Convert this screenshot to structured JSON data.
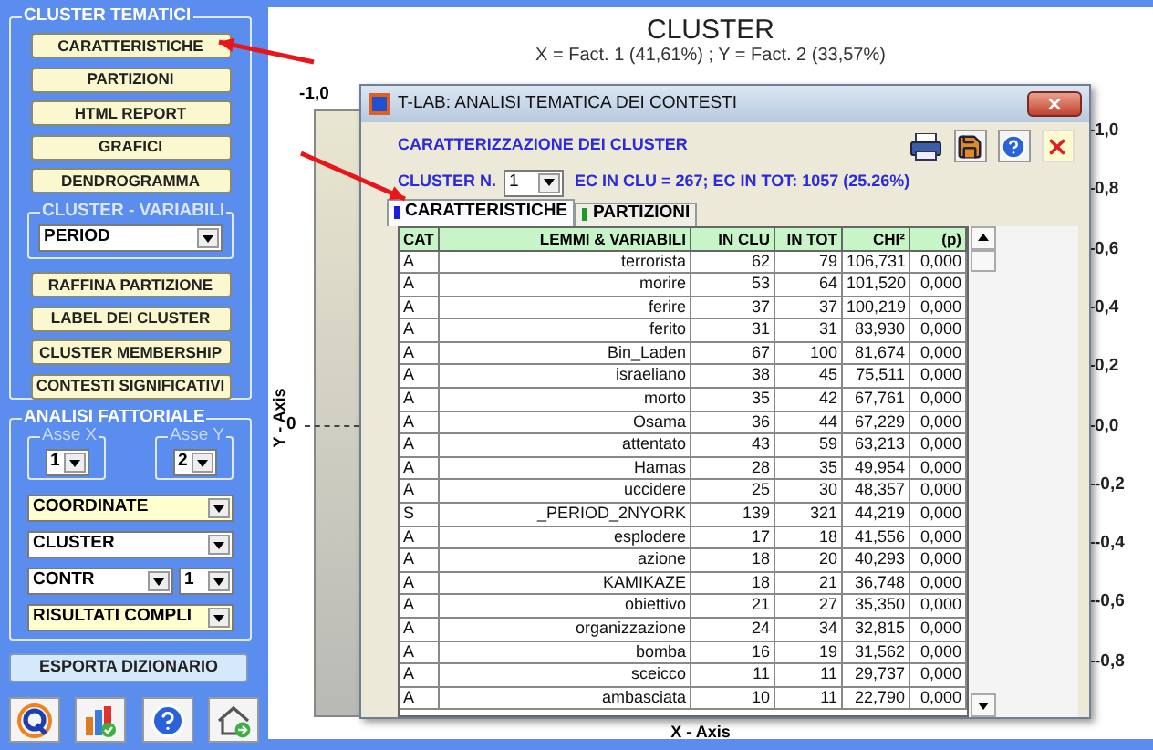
{
  "sidebar": {
    "cluster_group": {
      "title": "CLUSTER TEMATICI",
      "buttons": [
        "CARATTERISTICHE",
        "PARTIZIONI",
        "HTML REPORT",
        "GRAFICI",
        "DENDROGRAMMA"
      ],
      "variables": {
        "title": "CLUSTER - VARIABILI",
        "value": "PERIOD"
      },
      "buttons_2": [
        "RAFFINA PARTIZIONE",
        "LABEL DEI CLUSTER",
        "CLUSTER MEMBERSHIP",
        "CONTESTI SIGNIFICATIVI"
      ]
    },
    "factorial_group": {
      "title": "ANALISI FATTORIALE",
      "axis_x": {
        "label": "Asse X",
        "value": "1"
      },
      "axis_y": {
        "label": "Asse Y",
        "value": "2"
      },
      "select_rows": [
        [
          {
            "value": "COORDINATE",
            "highlighted": true
          }
        ],
        [
          {
            "value": "CLUSTER",
            "highlighted": false
          }
        ],
        [
          {
            "value": "CONTR",
            "highlighted": false
          },
          {
            "value": "1",
            "highlighted": false
          }
        ],
        [
          {
            "value": "RISULTATI COMPLI",
            "highlighted": true
          }
        ]
      ]
    },
    "export_button": "ESPORTA DIZIONARIO"
  },
  "chart": {
    "title": "CLUSTER",
    "subtitle": "X = Fact. 1 (41,61%) ; Y = Fact. 2 (33,57%)",
    "top_tick": "-1,0",
    "left_tick": "0",
    "right_ticks": [
      "1,0",
      "0,8",
      "0,6",
      "0,4",
      "0,2",
      "0,0",
      "-0,2",
      "-0,4",
      "-0,6",
      "-0,8"
    ],
    "x_axis_label": "X - Axis",
    "y_axis_label": "Y - Axis"
  },
  "dialog": {
    "title": "T-LAB: ANALISI TEMATICA DEI CONTESTI",
    "heading": "CARATTERIZZAZIONE DEI CLUSTER",
    "cluster_label": "CLUSTER N.",
    "cluster_value": "1",
    "summary": "EC IN CLU = 267; EC IN TOT: 1057 (25.26%)",
    "tabs": [
      {
        "label": "CARATTERISTICHE",
        "selected": true
      },
      {
        "label": "PARTIZIONI",
        "selected": false
      }
    ],
    "table": {
      "columns": [
        "CAT",
        "LEMMI & VARIABILI",
        "IN CLU",
        "IN TOT",
        "CHI²",
        "(p)"
      ],
      "rows": [
        [
          "A",
          "terrorista",
          "62",
          "79",
          "106,731",
          "0,000"
        ],
        [
          "A",
          "morire",
          "53",
          "64",
          "101,520",
          "0,000"
        ],
        [
          "A",
          "ferire",
          "37",
          "37",
          "100,219",
          "0,000"
        ],
        [
          "A",
          "ferito",
          "31",
          "31",
          "83,930",
          "0,000"
        ],
        [
          "A",
          "Bin_Laden",
          "67",
          "100",
          "81,674",
          "0,000"
        ],
        [
          "A",
          "israeliano",
          "38",
          "45",
          "75,511",
          "0,000"
        ],
        [
          "A",
          "morto",
          "35",
          "42",
          "67,761",
          "0,000"
        ],
        [
          "A",
          "Osama",
          "36",
          "44",
          "67,229",
          "0,000"
        ],
        [
          "A",
          "attentato",
          "43",
          "59",
          "63,213",
          "0,000"
        ],
        [
          "A",
          "Hamas",
          "28",
          "35",
          "49,954",
          "0,000"
        ],
        [
          "A",
          "uccidere",
          "25",
          "30",
          "48,357",
          "0,000"
        ],
        [
          "S",
          "_PERIOD_2NYORK",
          "139",
          "321",
          "44,219",
          "0,000"
        ],
        [
          "A",
          "esplodere",
          "17",
          "18",
          "41,556",
          "0,000"
        ],
        [
          "A",
          "azione",
          "18",
          "20",
          "40,293",
          "0,000"
        ],
        [
          "A",
          "KAMIKAZE",
          "18",
          "21",
          "36,748",
          "0,000"
        ],
        [
          "A",
          "obiettivo",
          "21",
          "27",
          "35,350",
          "0,000"
        ],
        [
          "A",
          "organizzazione",
          "24",
          "34",
          "32,815",
          "0,000"
        ],
        [
          "A",
          "bomba",
          "16",
          "19",
          "31,562",
          "0,000"
        ],
        [
          "A",
          "sceicco",
          "11",
          "11",
          "29,737",
          "0,000"
        ],
        [
          "A",
          "ambasciata",
          "10",
          "11",
          "22,790",
          "0,000"
        ]
      ]
    }
  }
}
